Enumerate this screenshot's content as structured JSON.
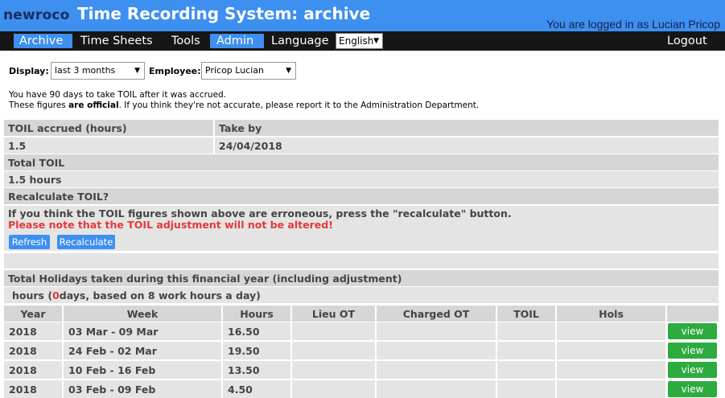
{
  "header": {
    "logo": "newroco",
    "title": "Time Recording System: archive",
    "logged_in": "You are logged in as Lucian Pricop"
  },
  "nav": {
    "items": [
      "Archive",
      "Time Sheets",
      "Tools",
      "Admin",
      "Language"
    ],
    "active_items": [
      "Archive",
      "Admin"
    ],
    "language_value": "English",
    "logout": "Logout"
  },
  "filters": {
    "display_label": "Display:",
    "display_value": "last 3 months",
    "employee_label": "Employee:",
    "employee_value": "Pricop Lucian"
  },
  "info": {
    "line1": "You have 90 days to take TOIL after it was accrued.",
    "line2_pre": "These figures ",
    "line2_bold": "are official",
    "line2_post": ". If you think they're not accurate, please report it to the Administration Department."
  },
  "toil": {
    "accrued_header": "TOIL accrued (hours)",
    "take_by_header": "Take by",
    "accrued_value": "1.5",
    "take_by_value": "24/04/2018",
    "total_header": "Total TOIL",
    "total_value": "1.5 hours",
    "recalc_header": "Recalculate TOIL?",
    "recalc_text": "If you think the TOIL figures shown above are erroneous, press the \"recalculate\" button.",
    "recalc_warning": "Please note that the TOIL adjustment will not be altered!",
    "refresh_button": "Refresh",
    "recalculate_button": "Recalculate"
  },
  "holidays": {
    "header": "Total Holidays taken during this financial year (including adjustment)",
    "hours_pre": "hours (",
    "days_value": "0",
    "hours_post": " days, based on 8 work hours a day)"
  },
  "weeks": {
    "columns": [
      "Year",
      "Week",
      "Hours",
      "Lieu OT",
      "Charged OT",
      "TOIL",
      "Hols",
      ""
    ],
    "rows": [
      {
        "year": "2018",
        "week": "03 Mar - 09 Mar",
        "hours": "16.50",
        "lieu_ot": "",
        "charged_ot": "",
        "toil": "",
        "hols": "",
        "action": "view"
      },
      {
        "year": "2018",
        "week": "24 Feb - 02 Mar",
        "hours": "19.50",
        "lieu_ot": "",
        "charged_ot": "",
        "toil": "",
        "hols": "",
        "action": "view"
      },
      {
        "year": "2018",
        "week": "10 Feb - 16 Feb",
        "hours": "13.50",
        "lieu_ot": "",
        "charged_ot": "",
        "toil": "",
        "hols": "",
        "action": "view"
      },
      {
        "year": "2018",
        "week": "03 Feb - 09 Feb",
        "hours": "4.50",
        "lieu_ot": "",
        "charged_ot": "",
        "toil": "",
        "hols": "",
        "action": "view"
      }
    ]
  },
  "colors": {
    "header_blue": "#3d8ff0",
    "nav_black": "#161616",
    "warning_red": "#e5393a",
    "view_green": "#2eab3f",
    "row_gray": "#e4e4e4",
    "header_gray": "#d6d6d6"
  }
}
